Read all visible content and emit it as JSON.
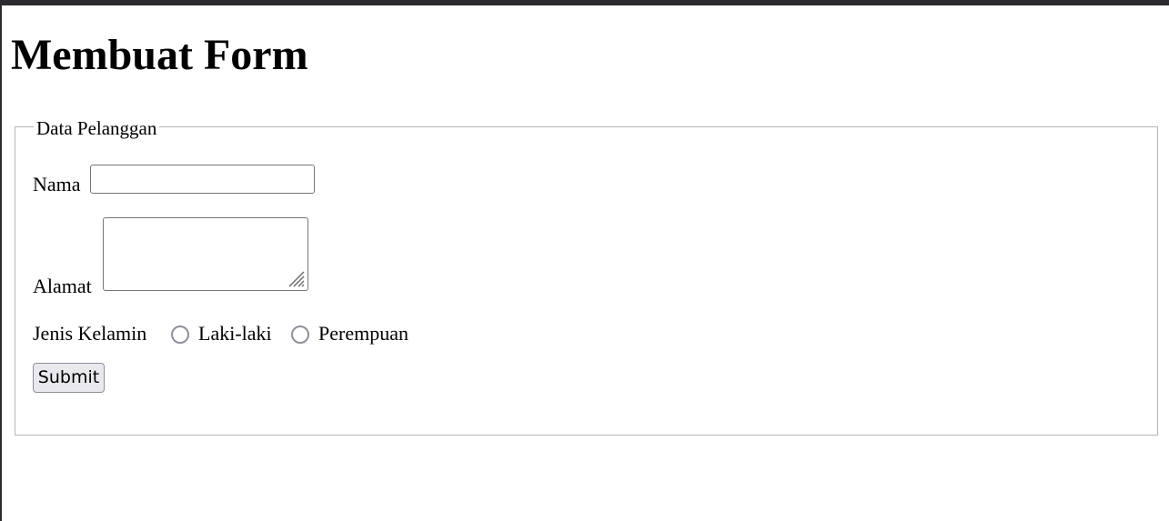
{
  "page": {
    "title": "Membuat Form"
  },
  "form": {
    "legend": "Data Pelanggan",
    "fields": {
      "nama": {
        "label": "Nama",
        "value": ""
      },
      "alamat": {
        "label": "Alamat",
        "value": ""
      },
      "jenis_kelamin": {
        "label": "Jenis Kelamin",
        "options": [
          "Laki-laki",
          "Perempuan"
        ],
        "selected": null
      }
    },
    "submit_label": "Submit"
  },
  "colors": {
    "control_border": "#767676",
    "radio_border": "#8f8f9d",
    "button_background": "#e9e9ed",
    "fieldset_border": "#b5b5b5"
  }
}
